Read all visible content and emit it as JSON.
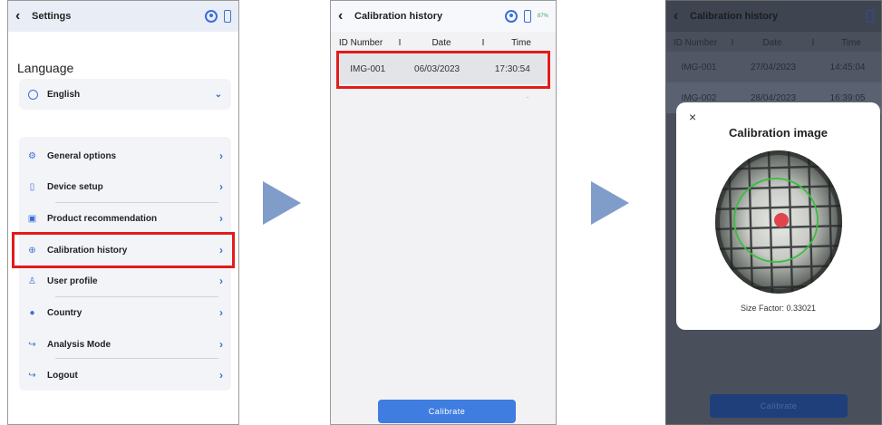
{
  "settings": {
    "title": "Settings",
    "language_label": "Language",
    "language_value": "English",
    "menu": [
      {
        "label": "General options",
        "icon": "gear-icon",
        "glyph": "⚙"
      },
      {
        "label": "Device setup",
        "icon": "device-icon",
        "glyph": "▯"
      },
      {
        "label": "Product recommendation",
        "icon": "image-icon",
        "glyph": "▣"
      },
      {
        "label": "Calibration history",
        "icon": "target-icon",
        "glyph": "⊕"
      },
      {
        "label": "User profile",
        "icon": "person-icon",
        "glyph": "♙"
      },
      {
        "label": "Country",
        "icon": "globe-icon",
        "glyph": "●"
      },
      {
        "label": "Analysis Mode",
        "icon": "exit-icon",
        "glyph": "↪"
      },
      {
        "label": "Logout",
        "icon": "logout-icon",
        "glyph": "↪"
      }
    ]
  },
  "history": {
    "title": "Calibration history",
    "battery": "87%",
    "columns": [
      "ID Number",
      "I",
      "Date",
      "I",
      "Time"
    ],
    "rows": [
      {
        "id": "IMG-001",
        "date": "06/03/2023",
        "time": "17:30:54"
      }
    ],
    "stray_mark": ".",
    "button": "Calibrate"
  },
  "detail": {
    "title": "Calibration history",
    "columns": [
      "ID Number",
      "I",
      "Date",
      "I",
      "Time"
    ],
    "rows": [
      {
        "id": "IMG-001",
        "date": "27/04/2023",
        "time": "14:45:04"
      },
      {
        "id": "IMG-002",
        "date": "28/04/2023",
        "time": "16:39:05"
      }
    ],
    "modal": {
      "title": "Calibration image",
      "close": "×",
      "caption": "Size Factor: 0.33021"
    },
    "button": "Calibrate"
  },
  "colors": {
    "accent": "#3b6fd8",
    "highlight": "#e31b1b",
    "flow_arrow": "#7f9dc8"
  }
}
